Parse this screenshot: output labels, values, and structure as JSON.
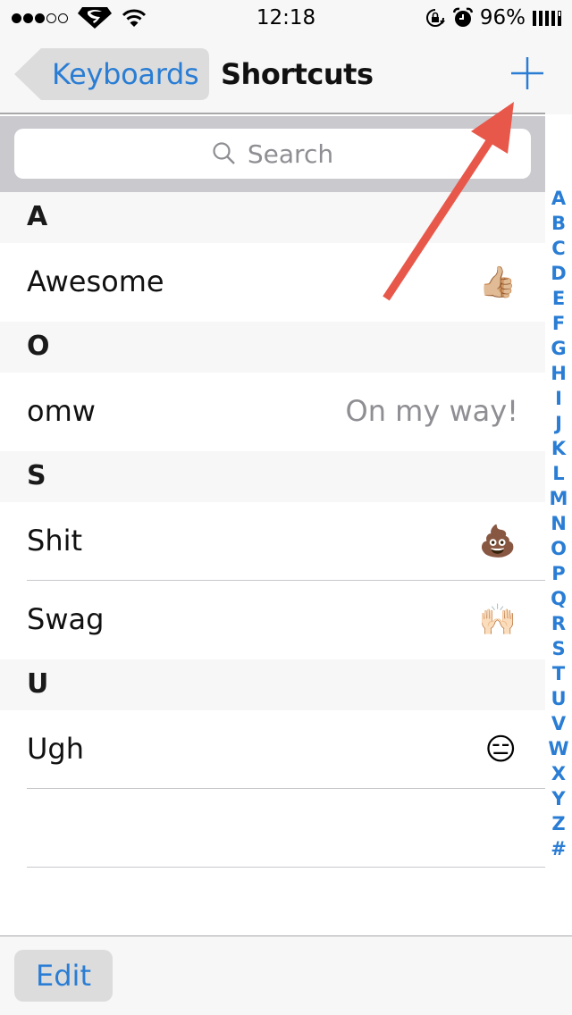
{
  "status_bar": {
    "signal_filled": 3,
    "signal_total": 5,
    "carrier_icon": "superman-logo-icon",
    "wifi_icon": "wifi-icon",
    "time": "12:18",
    "rotation_lock_icon": "rotation-lock-icon",
    "alarm_icon": "alarm-icon",
    "battery_percent": "96%"
  },
  "nav": {
    "back_label": "Keyboards",
    "title": "Shortcuts",
    "add_icon": "plus-icon"
  },
  "search": {
    "placeholder": "Search",
    "icon": "search-icon"
  },
  "sections": [
    {
      "letter": "A",
      "rows": [
        {
          "phrase": "Awesome",
          "shortcut": "👍🏼",
          "kind": "emoji",
          "emoji_name": "thumbs-up"
        }
      ]
    },
    {
      "letter": "O",
      "rows": [
        {
          "phrase": "omw",
          "shortcut": "On my way!",
          "kind": "text"
        }
      ]
    },
    {
      "letter": "S",
      "rows": [
        {
          "phrase": "Shit",
          "shortcut": "💩",
          "kind": "emoji",
          "emoji_name": "pile-of-poo"
        },
        {
          "phrase": "Swag",
          "shortcut": "🙌🏻",
          "kind": "emoji",
          "emoji_name": "raising-hands"
        }
      ]
    },
    {
      "letter": "U",
      "rows": [
        {
          "phrase": "Ugh",
          "shortcut": "😑",
          "kind": "emoji",
          "emoji_name": "expressionless-face"
        }
      ]
    }
  ],
  "index_letters": [
    "A",
    "B",
    "C",
    "D",
    "E",
    "F",
    "G",
    "H",
    "I",
    "J",
    "K",
    "L",
    "M",
    "N",
    "O",
    "P",
    "Q",
    "R",
    "S",
    "T",
    "U",
    "V",
    "W",
    "X",
    "Y",
    "Z",
    "#"
  ],
  "toolbar": {
    "edit_label": "Edit"
  },
  "annotation": {
    "type": "arrow",
    "color": "#e8584a",
    "points_to": "add-button"
  },
  "colors": {
    "accent": "#2a7dd4",
    "search_bg": "#c9c9ce",
    "bar_bg": "#f7f7f7",
    "secondary_text": "#8e8e93"
  }
}
